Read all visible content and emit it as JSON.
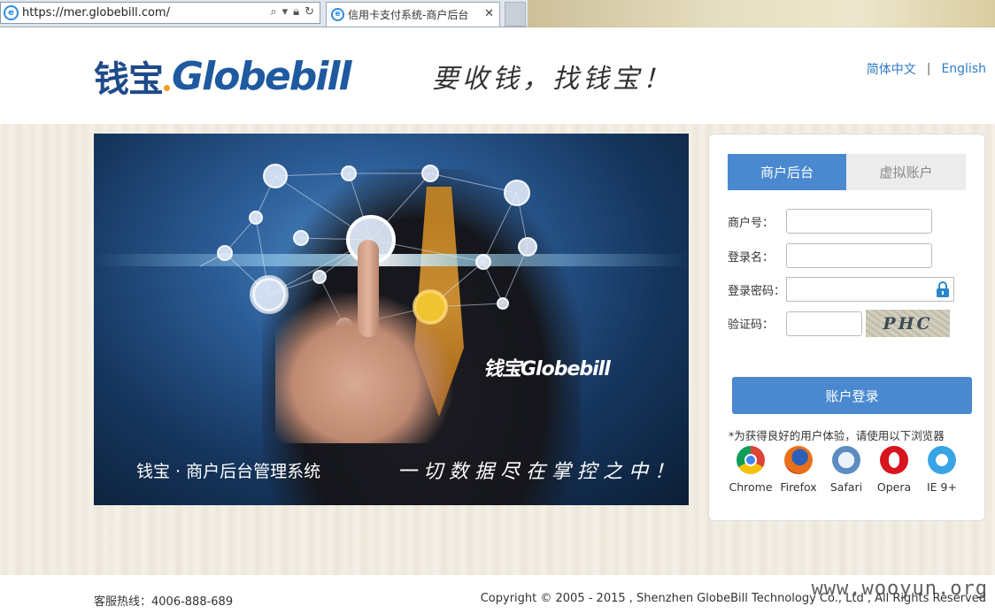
{
  "browser": {
    "url": "https://mer.globebill.com/",
    "tab_title": "信用卡支付系统-商户后台"
  },
  "header": {
    "logo_cn": "钱宝",
    "logo_en": "Globebill",
    "slogan": "要收钱，找钱宝！",
    "lang_cn": "简体中文",
    "lang_sep": "|",
    "lang_en": "English"
  },
  "banner": {
    "logo": "钱宝Globebill",
    "title": "钱宝 · 商户后台管理系统",
    "tagline": "一切数据尽在掌控之中！"
  },
  "login": {
    "tab_merchant": "商户后台",
    "tab_virtual": "虚拟账户",
    "merchant_no_label": "商户号：",
    "username_label": "登录名：",
    "password_label": "登录密码：",
    "captcha_label": "验证码：",
    "captcha_text": "PHC",
    "submit_label": "账户登录",
    "browser_tip": "*为获得良好的用户体验，请使用以下浏览器",
    "browsers": [
      "Chrome",
      "Firefox",
      "Safari",
      "Opera",
      "IE 9+"
    ]
  },
  "footer": {
    "hotline": "客服热线：4006-888-689",
    "copyright": "Copyright © 2005 - 2015 , Shenzhen GlobeBill Technology Co., Ltd , All Rights Reserved",
    "watermark": "www.wooyun.org"
  },
  "colors": {
    "brand_blue": "#1f4a8a",
    "accent_blue": "#4a89d0",
    "link_blue": "#2e7bc4"
  }
}
